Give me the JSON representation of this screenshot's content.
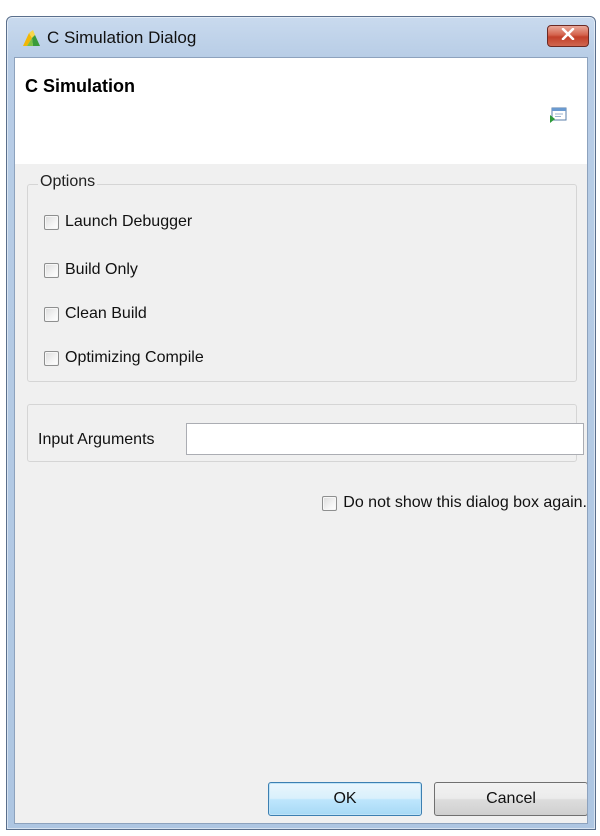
{
  "window": {
    "title": "C Simulation Dialog",
    "app_icon": "vivado-hls-icon",
    "close_icon": "close-icon"
  },
  "header": {
    "title": "C Simulation",
    "icon": "run-window-icon"
  },
  "options": {
    "legend": "Options",
    "items": [
      {
        "label": "Launch Debugger",
        "checked": false
      },
      {
        "label": "Build Only",
        "checked": false
      },
      {
        "label": "Clean Build",
        "checked": false
      },
      {
        "label": "Optimizing Compile",
        "checked": false
      }
    ]
  },
  "input_arguments": {
    "label": "Input Arguments",
    "value": ""
  },
  "dont_show": {
    "label": "Do not show this dialog box again.",
    "checked": false
  },
  "buttons": {
    "ok": "OK",
    "cancel": "Cancel"
  }
}
